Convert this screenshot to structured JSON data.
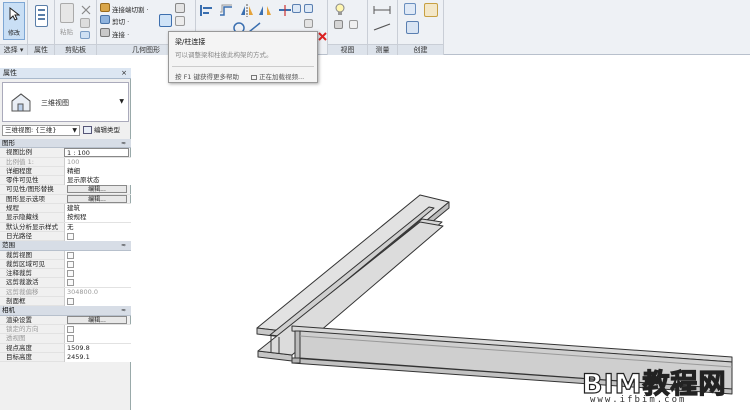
{
  "ribbon": {
    "modify_label": "修改",
    "select_label": "选择 ▾",
    "properties_label": "属性",
    "clipboard_label": "剪贴板",
    "paste_label": "粘贴",
    "geometry_label": "几何图形",
    "cut_label": "剪切 ·",
    "join_label": "连接 ·",
    "cope_label": "连接端切割 ·",
    "view_label": "视图",
    "measure_label": "测量",
    "create_label": "创建"
  },
  "tooltip": {
    "title": "梁/柱连接",
    "description": "可以调整梁和柱彼此构架的方式。",
    "help_hint": "按 F1 键获得更多帮助",
    "video": "正在加载视频..."
  },
  "properties": {
    "title": "属性",
    "close": "×",
    "type_name": "三维视图",
    "filter_value": "三维视图: {三维}",
    "edit_type": "编辑类型",
    "sections": [
      {
        "name": "图形",
        "toggle": "≈",
        "rows": [
          {
            "key": "视图比例",
            "value": "1 : 100",
            "kind": "box"
          },
          {
            "key": "比例值 1:",
            "value": "100",
            "kind": "dim"
          },
          {
            "key": "详细程度",
            "value": "精细",
            "kind": "text"
          },
          {
            "key": "零件可见性",
            "value": "显示原状态",
            "kind": "text"
          },
          {
            "key": "可见性/图形替换",
            "value": "编辑...",
            "kind": "button"
          },
          {
            "key": "图形显示选项",
            "value": "编辑...",
            "kind": "button"
          },
          {
            "key": "规程",
            "value": "建筑",
            "kind": "text"
          },
          {
            "key": "显示隐藏线",
            "value": "按规程",
            "kind": "text"
          },
          {
            "key": "默认分析显示样式",
            "value": "无",
            "kind": "text"
          },
          {
            "key": "日光路径",
            "value": "",
            "kind": "check"
          }
        ]
      },
      {
        "name": "范围",
        "toggle": "≈",
        "rows": [
          {
            "key": "裁剪视图",
            "value": "",
            "kind": "check"
          },
          {
            "key": "裁剪区域可见",
            "value": "",
            "kind": "check"
          },
          {
            "key": "注释裁剪",
            "value": "",
            "kind": "check"
          },
          {
            "key": "远剪裁激活",
            "value": "",
            "kind": "check"
          },
          {
            "key": "远剪裁偏移",
            "value": "304800.0",
            "kind": "dim"
          },
          {
            "key": "剖面框",
            "value": "",
            "kind": "check"
          }
        ]
      },
      {
        "name": "相机",
        "toggle": "≈",
        "rows": [
          {
            "key": "渲染设置",
            "value": "编辑...",
            "kind": "button"
          },
          {
            "key": "锁定的方向",
            "value": "",
            "kind": "check-dim"
          },
          {
            "key": "透视图",
            "value": "",
            "kind": "check-dim"
          },
          {
            "key": "视点高度",
            "value": "1509.8",
            "kind": "text"
          },
          {
            "key": "目标高度",
            "value": "2459.1",
            "kind": "text"
          }
        ]
      }
    ]
  },
  "watermark": {
    "brand": "BIM教程网",
    "url": "www.ifbim.com"
  },
  "colors": {
    "ribbon_bg": "#eef1f5",
    "selected_btn": "#c9dff5",
    "beam_top": "#d8d8d8",
    "beam_side": "#c4c4c4",
    "beam_edge": "#333333"
  }
}
